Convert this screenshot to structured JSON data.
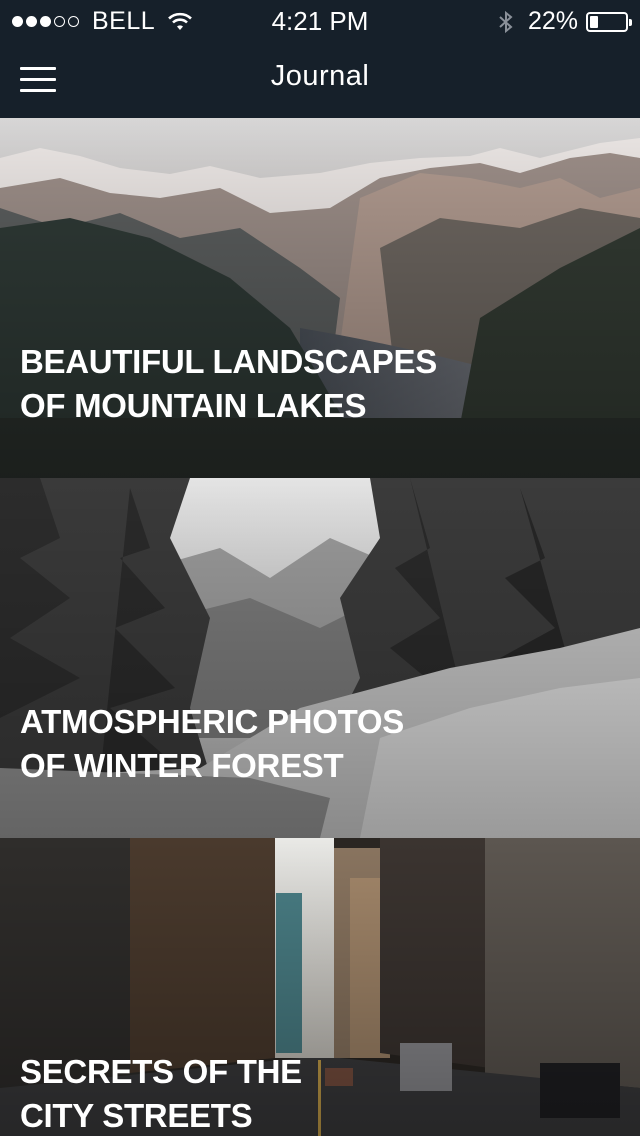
{
  "status_bar": {
    "carrier": "BELL",
    "time": "4:21 PM",
    "battery_percent": "22%",
    "signal_bars_filled": 3,
    "signal_bars_total": 5,
    "battery_level": 0.22
  },
  "nav": {
    "title": "Journal",
    "menu_icon": "hamburger-menu-icon"
  },
  "articles": [
    {
      "title_line1": "BEAUTIFUL LANDSCAPES",
      "title_line2": "OF MOUNTAIN LAKES"
    },
    {
      "title_line1": "ATMOSPHERIC PHOTOS",
      "title_line2": "OF WINTER FOREST"
    },
    {
      "title_line1": "SECRETS OF THE",
      "title_line2": "CITY STREETS"
    }
  ]
}
